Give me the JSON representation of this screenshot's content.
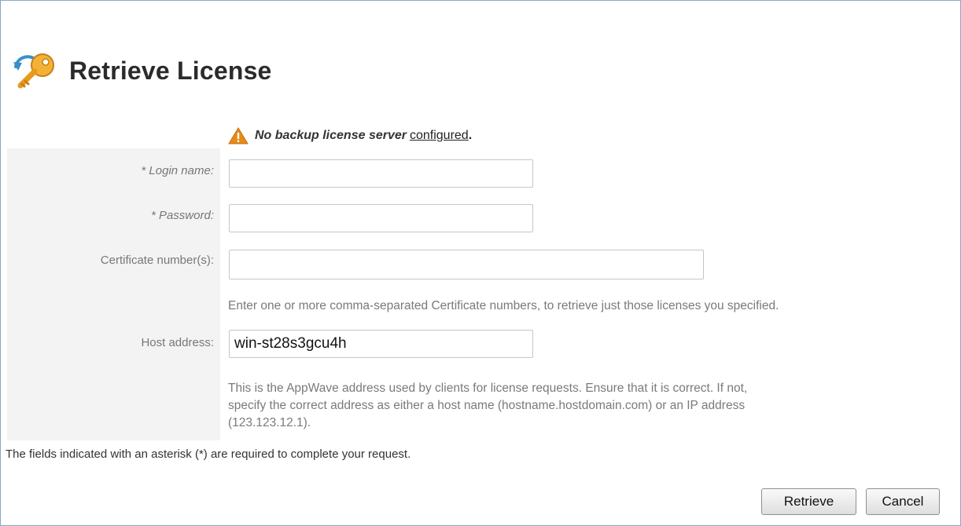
{
  "page": {
    "title": "Retrieve License",
    "title_icon": "key-refresh-icon"
  },
  "warning": {
    "icon": "warning-triangle-icon",
    "message": "No backup license server",
    "link_text": "configured",
    "suffix": "."
  },
  "form": {
    "login": {
      "label": "* Login name:",
      "value": ""
    },
    "password": {
      "label": "* Password:",
      "value": ""
    },
    "certificate": {
      "label": "Certificate number(s):",
      "value": "",
      "hint": "Enter one or more comma-separated Certificate numbers, to retrieve just those licenses you specified."
    },
    "host": {
      "label": "Host address:",
      "value": "win-st28s3gcu4h",
      "hint_line1": "This is the AppWave address used by clients for license requests. Ensure that it is correct. If not,",
      "hint_line2": "specify the correct address as either a host name (hostname.hostdomain.com) or an IP address",
      "hint_line3": "(123.123.12.1)."
    }
  },
  "footnote": "The fields indicated with an asterisk (*) are required to complete your request.",
  "buttons": {
    "retrieve": "Retrieve",
    "cancel": "Cancel"
  },
  "colors": {
    "accent_key": "#e89a1c",
    "warning": "#e8891a",
    "border": "#8aa6c7"
  }
}
